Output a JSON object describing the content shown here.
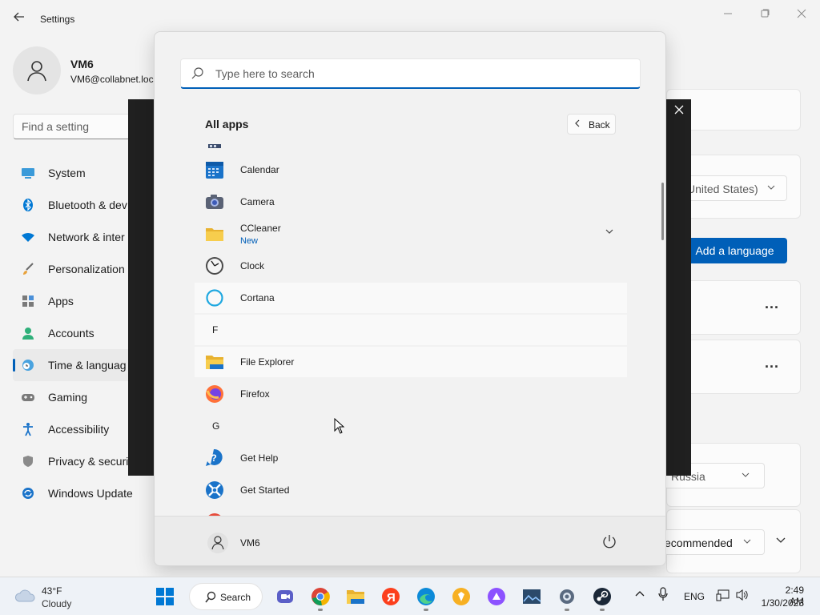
{
  "settings": {
    "title": "Settings",
    "user": {
      "name": "VM6",
      "email": "VM6@collabnet.loc"
    },
    "search_placeholder": "Find a setting",
    "nav": [
      {
        "label": "System",
        "icon": "monitor-icon"
      },
      {
        "label": "Bluetooth & dev",
        "icon": "bluetooth-icon"
      },
      {
        "label": "Network & inter",
        "icon": "wifi-icon"
      },
      {
        "label": "Personalization",
        "icon": "brush-icon"
      },
      {
        "label": "Apps",
        "icon": "apps-icon"
      },
      {
        "label": "Accounts",
        "icon": "accounts-icon"
      },
      {
        "label": "Time & languag",
        "icon": "globe-clock-icon",
        "active": true
      },
      {
        "label": "Gaming",
        "icon": "gamepad-icon"
      },
      {
        "label": "Accessibility",
        "icon": "accessibility-icon"
      },
      {
        "label": "Privacy & securi",
        "icon": "shield-icon"
      },
      {
        "label": "Windows Update",
        "icon": "update-icon"
      }
    ],
    "right": {
      "display_language_value": "United States)",
      "add_language_label": "Add a language",
      "more_label": "...",
      "region_value": "Russia",
      "format_value": "ecommended"
    }
  },
  "start_menu": {
    "search_placeholder": "Type here to search",
    "all_apps_title": "All apps",
    "back_label": "Back",
    "apps": [
      {
        "type": "app",
        "label": "Calendar",
        "icon": "calendar-icon"
      },
      {
        "type": "app",
        "label": "Camera",
        "icon": "camera-icon"
      },
      {
        "type": "app",
        "label": "CCleaner",
        "sub": "New",
        "icon": "folder-icon",
        "expandable": true
      },
      {
        "type": "app",
        "label": "Clock",
        "icon": "clock-icon"
      },
      {
        "type": "app",
        "label": "Cortana",
        "icon": "cortana-icon"
      },
      {
        "type": "letter",
        "label": "F"
      },
      {
        "type": "app",
        "label": "File Explorer",
        "icon": "file-explorer-icon"
      },
      {
        "type": "app",
        "label": "Firefox",
        "icon": "firefox-icon"
      },
      {
        "type": "letter",
        "label": "G"
      },
      {
        "type": "app",
        "label": "Get Help",
        "icon": "get-help-icon"
      },
      {
        "type": "app",
        "label": "Get Started",
        "icon": "get-started-icon"
      }
    ],
    "user_name": "VM6"
  },
  "taskbar": {
    "weather": {
      "temp": "43°F",
      "desc": "Cloudy"
    },
    "search_label": "Search",
    "apps": [
      "start-icon",
      "teams-icon",
      "chrome-icon",
      "file-explorer-icon",
      "yandex-icon",
      "edge-icon",
      "brave-icon",
      "alice-icon",
      "photos-icon",
      "settings-icon",
      "steam-icon"
    ],
    "lang": "ENG",
    "time": "2:49 AM",
    "date": "1/30/2023"
  }
}
